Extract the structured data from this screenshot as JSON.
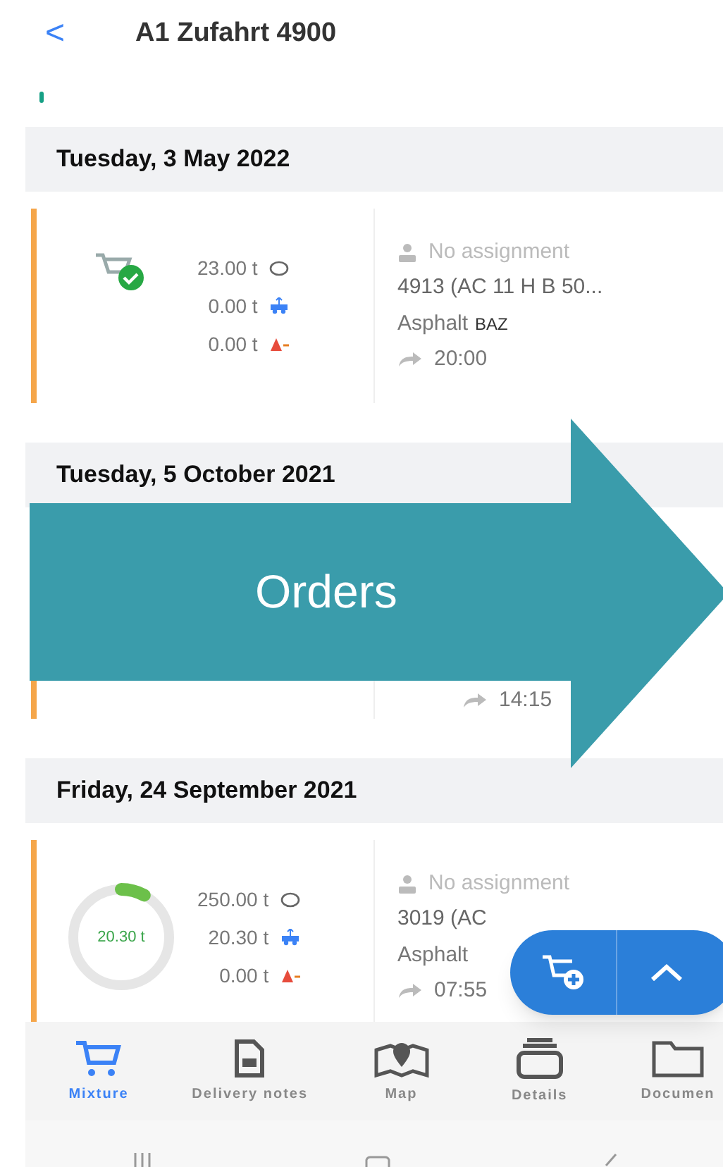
{
  "header": {
    "back": "<",
    "title": "A1 Zufahrt 4900"
  },
  "groups": [
    {
      "date": "Tuesday, 3 May 2022",
      "order": {
        "kind": "done",
        "amounts": [
          {
            "value": "23.00 t",
            "kind": "total"
          },
          {
            "value": "0.00 t",
            "kind": "delivered"
          },
          {
            "value": "0.00 t",
            "kind": "rest"
          }
        ],
        "assignment": "No assignment",
        "mixture": "4913 (AC 11 H B 50...",
        "material": "Asphalt",
        "site": "BAZ",
        "time": "20:00"
      }
    },
    {
      "date": "Tuesday, 5 October 2021",
      "order": {
        "time": "14:15"
      }
    },
    {
      "date": "Friday, 24 September 2021",
      "order": {
        "kind": "ring",
        "ring_label": "20.30 t",
        "level": 0.08,
        "amounts": [
          {
            "value": "250.00 t",
            "kind": "total"
          },
          {
            "value": "20.30 t",
            "kind": "delivered"
          },
          {
            "value": "0.00 t",
            "kind": "rest"
          }
        ],
        "assignment": "No assignment",
        "mixture": "3019 (AC",
        "material": "Asphalt",
        "time": "07:55"
      }
    }
  ],
  "annotation": {
    "text": "Orders"
  },
  "tabs": [
    {
      "label": "Mixture",
      "selected": true
    },
    {
      "label": "Delivery notes",
      "selected": false
    },
    {
      "label": "Map",
      "selected": false
    },
    {
      "label": "Details",
      "selected": false
    },
    {
      "label": "Documen",
      "selected": false
    }
  ]
}
